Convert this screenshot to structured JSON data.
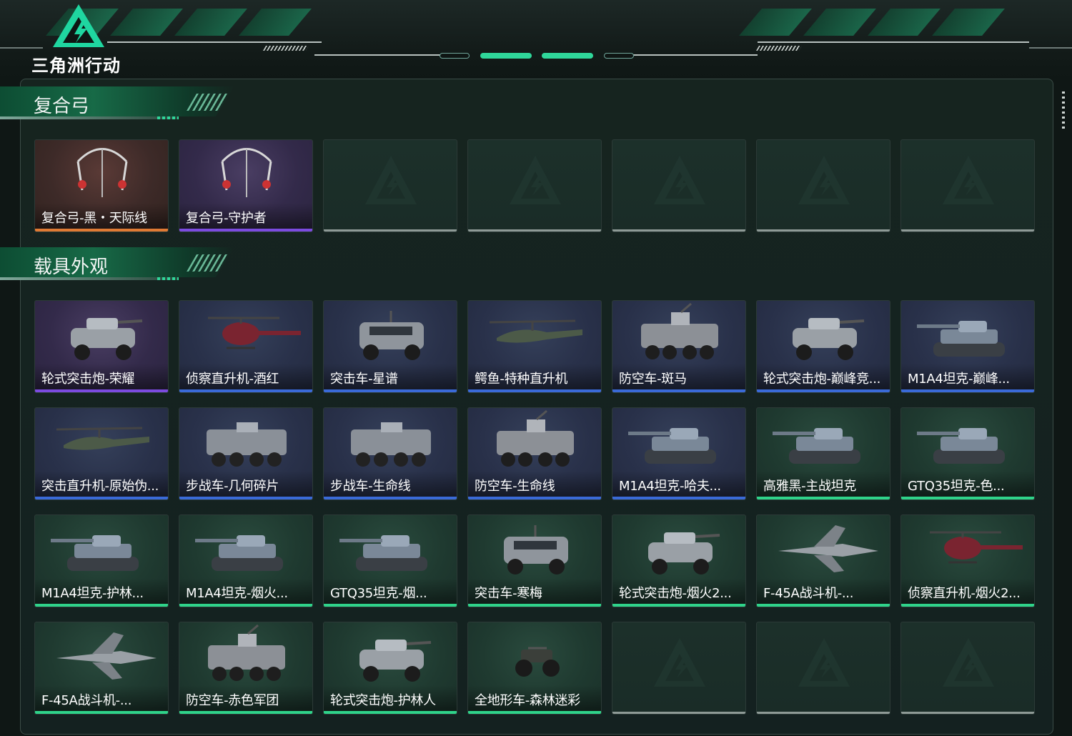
{
  "game": {
    "title": "三角洲行动"
  },
  "sections": {
    "bow": {
      "title": "复合弓",
      "items": [
        {
          "name": "复合弓-黑・天际线",
          "rarity": "orange",
          "icon": "compound-bow-icon"
        },
        {
          "name": "复合弓-守护者",
          "rarity": "purple",
          "icon": "compound-bow-icon"
        },
        {
          "name": "",
          "rarity": "empty",
          "icon": ""
        },
        {
          "name": "",
          "rarity": "empty",
          "icon": ""
        },
        {
          "name": "",
          "rarity": "empty",
          "icon": ""
        },
        {
          "name": "",
          "rarity": "empty",
          "icon": ""
        },
        {
          "name": "",
          "rarity": "empty",
          "icon": ""
        }
      ]
    },
    "vehicle": {
      "title": "载具外观",
      "items": [
        {
          "name": "轮式突击炮-荣耀",
          "rarity": "purple",
          "icon": "wheeled-assault-gun-icon"
        },
        {
          "name": "侦察直升机-酒红",
          "rarity": "blue",
          "icon": "scout-helicopter-icon"
        },
        {
          "name": "突击车-星谱",
          "rarity": "blue",
          "icon": "assault-vehicle-icon"
        },
        {
          "name": "鳄鱼-特种直升机",
          "rarity": "blue",
          "icon": "attack-helicopter-icon"
        },
        {
          "name": "防空车-斑马",
          "rarity": "blue",
          "icon": "aa-vehicle-icon"
        },
        {
          "name": "轮式突击炮-巅峰竞...",
          "rarity": "blue",
          "icon": "wheeled-assault-gun-icon"
        },
        {
          "name": "M1A4坦克-巅峰...",
          "rarity": "blue",
          "icon": "tank-icon"
        },
        {
          "name": "突击直升机-原始伪...",
          "rarity": "blue",
          "icon": "attack-helicopter-icon"
        },
        {
          "name": "步战车-几何碎片",
          "rarity": "blue",
          "icon": "ifv-icon"
        },
        {
          "name": "步战车-生命线",
          "rarity": "blue",
          "icon": "ifv-icon"
        },
        {
          "name": "防空车-生命线",
          "rarity": "blue",
          "icon": "aa-vehicle-icon"
        },
        {
          "name": "M1A4坦克-哈夫...",
          "rarity": "blue",
          "icon": "tank-icon"
        },
        {
          "name": "高雅黑-主战坦克",
          "rarity": "green",
          "icon": "tank-icon"
        },
        {
          "name": "GTQ35坦克-色...",
          "rarity": "green",
          "icon": "tank-icon"
        },
        {
          "name": "M1A4坦克-护林...",
          "rarity": "green",
          "icon": "tank-icon"
        },
        {
          "name": "M1A4坦克-烟火...",
          "rarity": "green",
          "icon": "tank-icon"
        },
        {
          "name": "GTQ35坦克-烟...",
          "rarity": "green",
          "icon": "tank-icon"
        },
        {
          "name": "突击车-寒梅",
          "rarity": "green",
          "icon": "assault-vehicle-icon"
        },
        {
          "name": "轮式突击炮-烟火2...",
          "rarity": "green",
          "icon": "wheeled-assault-gun-icon"
        },
        {
          "name": "F-45A战斗机-...",
          "rarity": "green",
          "icon": "fighter-jet-icon"
        },
        {
          "name": "侦察直升机-烟火2...",
          "rarity": "green",
          "icon": "scout-helicopter-icon"
        },
        {
          "name": "F-45A战斗机-...",
          "rarity": "green",
          "icon": "fighter-jet-icon"
        },
        {
          "name": "防空车-赤色军团",
          "rarity": "green",
          "icon": "aa-vehicle-icon"
        },
        {
          "name": "轮式突击炮-护林人",
          "rarity": "green",
          "icon": "wheeled-assault-gun-icon"
        },
        {
          "name": "全地形车-森林迷彩",
          "rarity": "green",
          "icon": "atv-icon"
        },
        {
          "name": "",
          "rarity": "empty",
          "icon": ""
        },
        {
          "name": "",
          "rarity": "empty",
          "icon": ""
        },
        {
          "name": "",
          "rarity": "empty",
          "icon": ""
        }
      ]
    }
  },
  "colors": {
    "purple": "#7c4be0",
    "orange": "#e07a34",
    "blue": "#3a6ad8",
    "green": "#2fd38a",
    "accent": "#2fd79a"
  }
}
